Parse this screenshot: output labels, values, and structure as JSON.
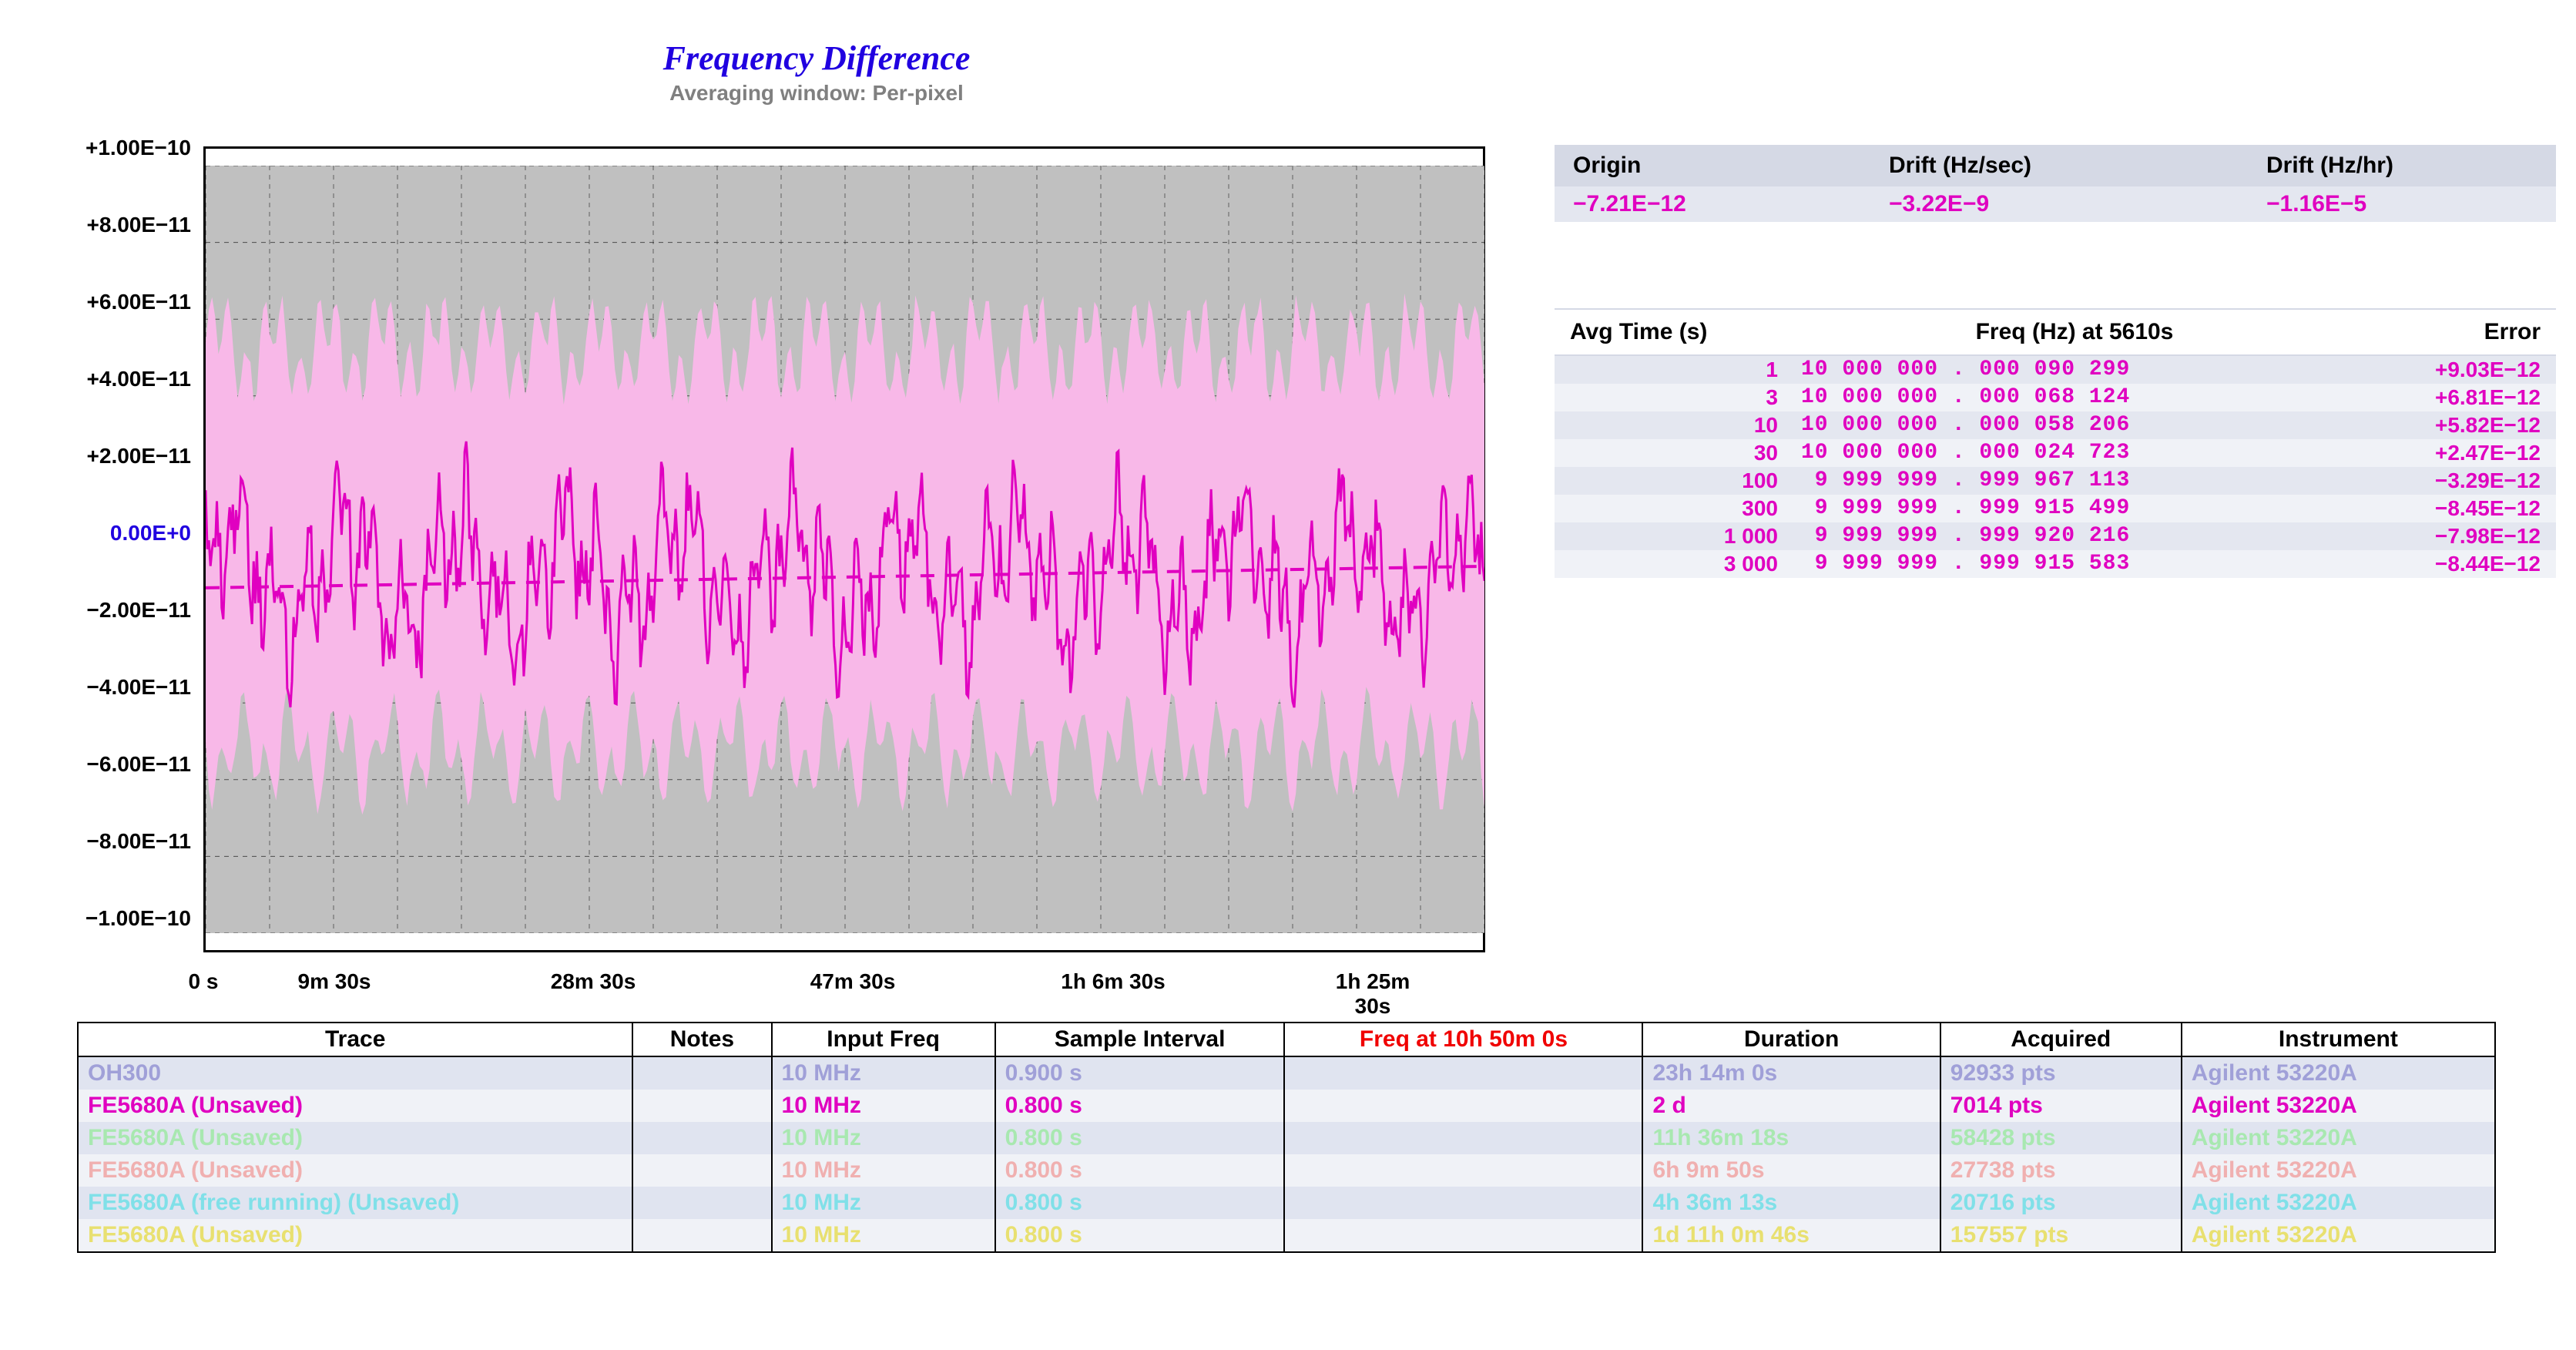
{
  "title": "Frequency Difference",
  "subtitle": "Averaging window: Per-pixel",
  "chart_data": {
    "type": "line",
    "title": "Frequency Difference",
    "subtitle": "Averaging window: Per-pixel",
    "xlabel": "",
    "ylabel": "",
    "yticks": [
      "+1.00E−10",
      "+8.00E−11",
      "+6.00E−11",
      "+4.00E−11",
      "+2.00E−11",
      "0.00E+0",
      "−2.00E−11",
      "−4.00E−11",
      "−6.00E−11",
      "−8.00E−11",
      "−1.00E−10"
    ],
    "ylim": [
      -1e-10,
      1e-10
    ],
    "xticks": [
      "0 s",
      "9m 30s",
      "28m 30s",
      "47m 30s",
      "1h 6m 30s",
      "1h 25m 30s"
    ],
    "xlim_seconds": [
      0,
      5610
    ],
    "series": [
      {
        "name": "FE5680A (Unsaved) raw band",
        "description": "Light-pink noise band spanning roughly −6e−11 to +6e−11 across the full x range",
        "color": "#f8b8e8"
      },
      {
        "name": "FE5680A (Unsaved) averaged",
        "description": "Magenta noisy line oscillating roughly between −4e−11 and +3e−11",
        "color": "#e000c0"
      },
      {
        "name": "Trend / mean",
        "description": "Dashed magenta near-horizontal line near −0.72e−11",
        "color": "#e000c0",
        "dashed": true,
        "approx_value": -7.21e-12
      }
    ],
    "sample_trace_points_seconds_vs_dimensionless": [
      [
        0,
        5e-12
      ],
      [
        120,
        1.5e-11
      ],
      [
        300,
        -2e-11
      ],
      [
        570,
        2.5e-11
      ],
      [
        800,
        -3.2e-11
      ],
      [
        1140,
        1e-11
      ],
      [
        1500,
        -1.5e-11
      ],
      [
        1710,
        5e-12
      ],
      [
        2000,
        -2.5e-11
      ],
      [
        2280,
        1.2e-11
      ],
      [
        2600,
        -1e-11
      ],
      [
        2850,
        1.8e-11
      ],
      [
        3100,
        -2.8e-11
      ],
      [
        3420,
        8e-12
      ],
      [
        3700,
        -1.2e-11
      ],
      [
        3990,
        1.5e-11
      ],
      [
        4300,
        -3e-11
      ],
      [
        4560,
        5e-12
      ],
      [
        4900,
        -2e-11
      ],
      [
        5130,
        1.8e-11
      ],
      [
        5400,
        -1e-11
      ],
      [
        5610,
        1.2e-11
      ]
    ]
  },
  "drift_panel": {
    "headers": [
      "Origin",
      "Drift (Hz/sec)",
      "Drift (Hz/hr)"
    ],
    "row": [
      "−7.21E−12",
      "−3.22E−9",
      "−1.16E−5"
    ]
  },
  "avg_panel": {
    "headers": [
      "Avg Time (s)",
      "Freq (Hz) at 5610s",
      "Error"
    ],
    "rows": [
      {
        "t": "1",
        "f": "10 000 000 . 000 090 299",
        "e": "+9.03E−12"
      },
      {
        "t": "3",
        "f": "10 000 000 . 000 068 124",
        "e": "+6.81E−12"
      },
      {
        "t": "10",
        "f": "10 000 000 . 000 058 206",
        "e": "+5.82E−12"
      },
      {
        "t": "30",
        "f": "10 000 000 . 000 024 723",
        "e": "+2.47E−12"
      },
      {
        "t": "100",
        "f": " 9 999 999 . 999 967 113",
        "e": "−3.29E−12"
      },
      {
        "t": "300",
        "f": " 9 999 999 . 999 915 499",
        "e": "−8.45E−12"
      },
      {
        "t": "1 000",
        "f": " 9 999 999 . 999 920 216",
        "e": "−7.98E−12"
      },
      {
        "t": "3 000",
        "f": " 9 999 999 . 999 915 583",
        "e": "−8.44E−12"
      }
    ]
  },
  "trace_table": {
    "headers": [
      "Trace",
      "Notes",
      "Input Freq",
      "Sample Interval",
      "Freq at 10h 50m 0s",
      "Duration",
      "Acquired",
      "Instrument"
    ],
    "rows": [
      {
        "cls": "c-lav",
        "cells": [
          "OH300",
          "",
          "10 MHz",
          "0.900 s",
          "",
          "23h 14m 0s",
          "92933 pts",
          "Agilent 53220A"
        ]
      },
      {
        "cls": "c-mag",
        "cells": [
          "FE5680A (Unsaved)",
          "",
          "10 MHz",
          "0.800 s",
          "",
          "2 d",
          "7014 pts",
          "Agilent 53220A"
        ]
      },
      {
        "cls": "c-lgn",
        "cells": [
          "FE5680A (Unsaved)",
          "",
          "10 MHz",
          "0.800 s",
          "",
          "11h 36m 18s",
          "58428 pts",
          "Agilent 53220A"
        ]
      },
      {
        "cls": "c-pnk",
        "cells": [
          "FE5680A (Unsaved)",
          "",
          "10 MHz",
          "0.800 s",
          "",
          "6h 9m 50s",
          "27738 pts",
          "Agilent 53220A"
        ]
      },
      {
        "cls": "c-cyn",
        "cells": [
          "FE5680A (free running) (Unsaved)",
          "",
          "10 MHz",
          "0.800 s",
          "",
          "4h 36m 13s",
          "20716 pts",
          "Agilent 53220A"
        ]
      },
      {
        "cls": "c-yel",
        "cells": [
          "FE5680A (Unsaved)",
          "",
          "10 MHz",
          "0.800 s",
          "",
          "1d 11h 0m 46s",
          "157557 pts",
          "Agilent 53220A"
        ]
      }
    ]
  }
}
